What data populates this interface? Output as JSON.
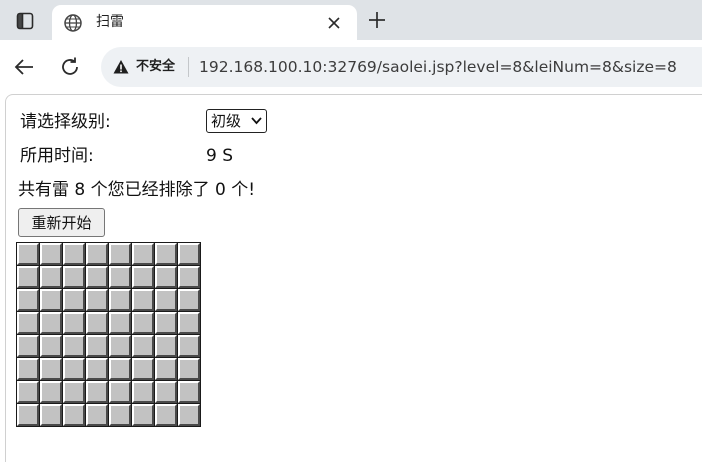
{
  "browser": {
    "tab_title": "扫雷",
    "security_label": "不安全",
    "url": "192.168.100.10:32769/saolei.jsp?level=8&leiNum=8&size=8"
  },
  "page": {
    "level_label": "请选择级别:",
    "level_selected": "初级",
    "time_label": "所用时间:",
    "time_value": "9 S",
    "mine_info": "共有雷 8 个您已经排除了 0 个!",
    "restart_label": "重新开始"
  },
  "board": {
    "rows": 8,
    "cols": 8,
    "cell_state": "unrevealed"
  },
  "colors": {
    "cell_face": "#c2c2c2",
    "tab_strip": "#dfe3e7"
  }
}
